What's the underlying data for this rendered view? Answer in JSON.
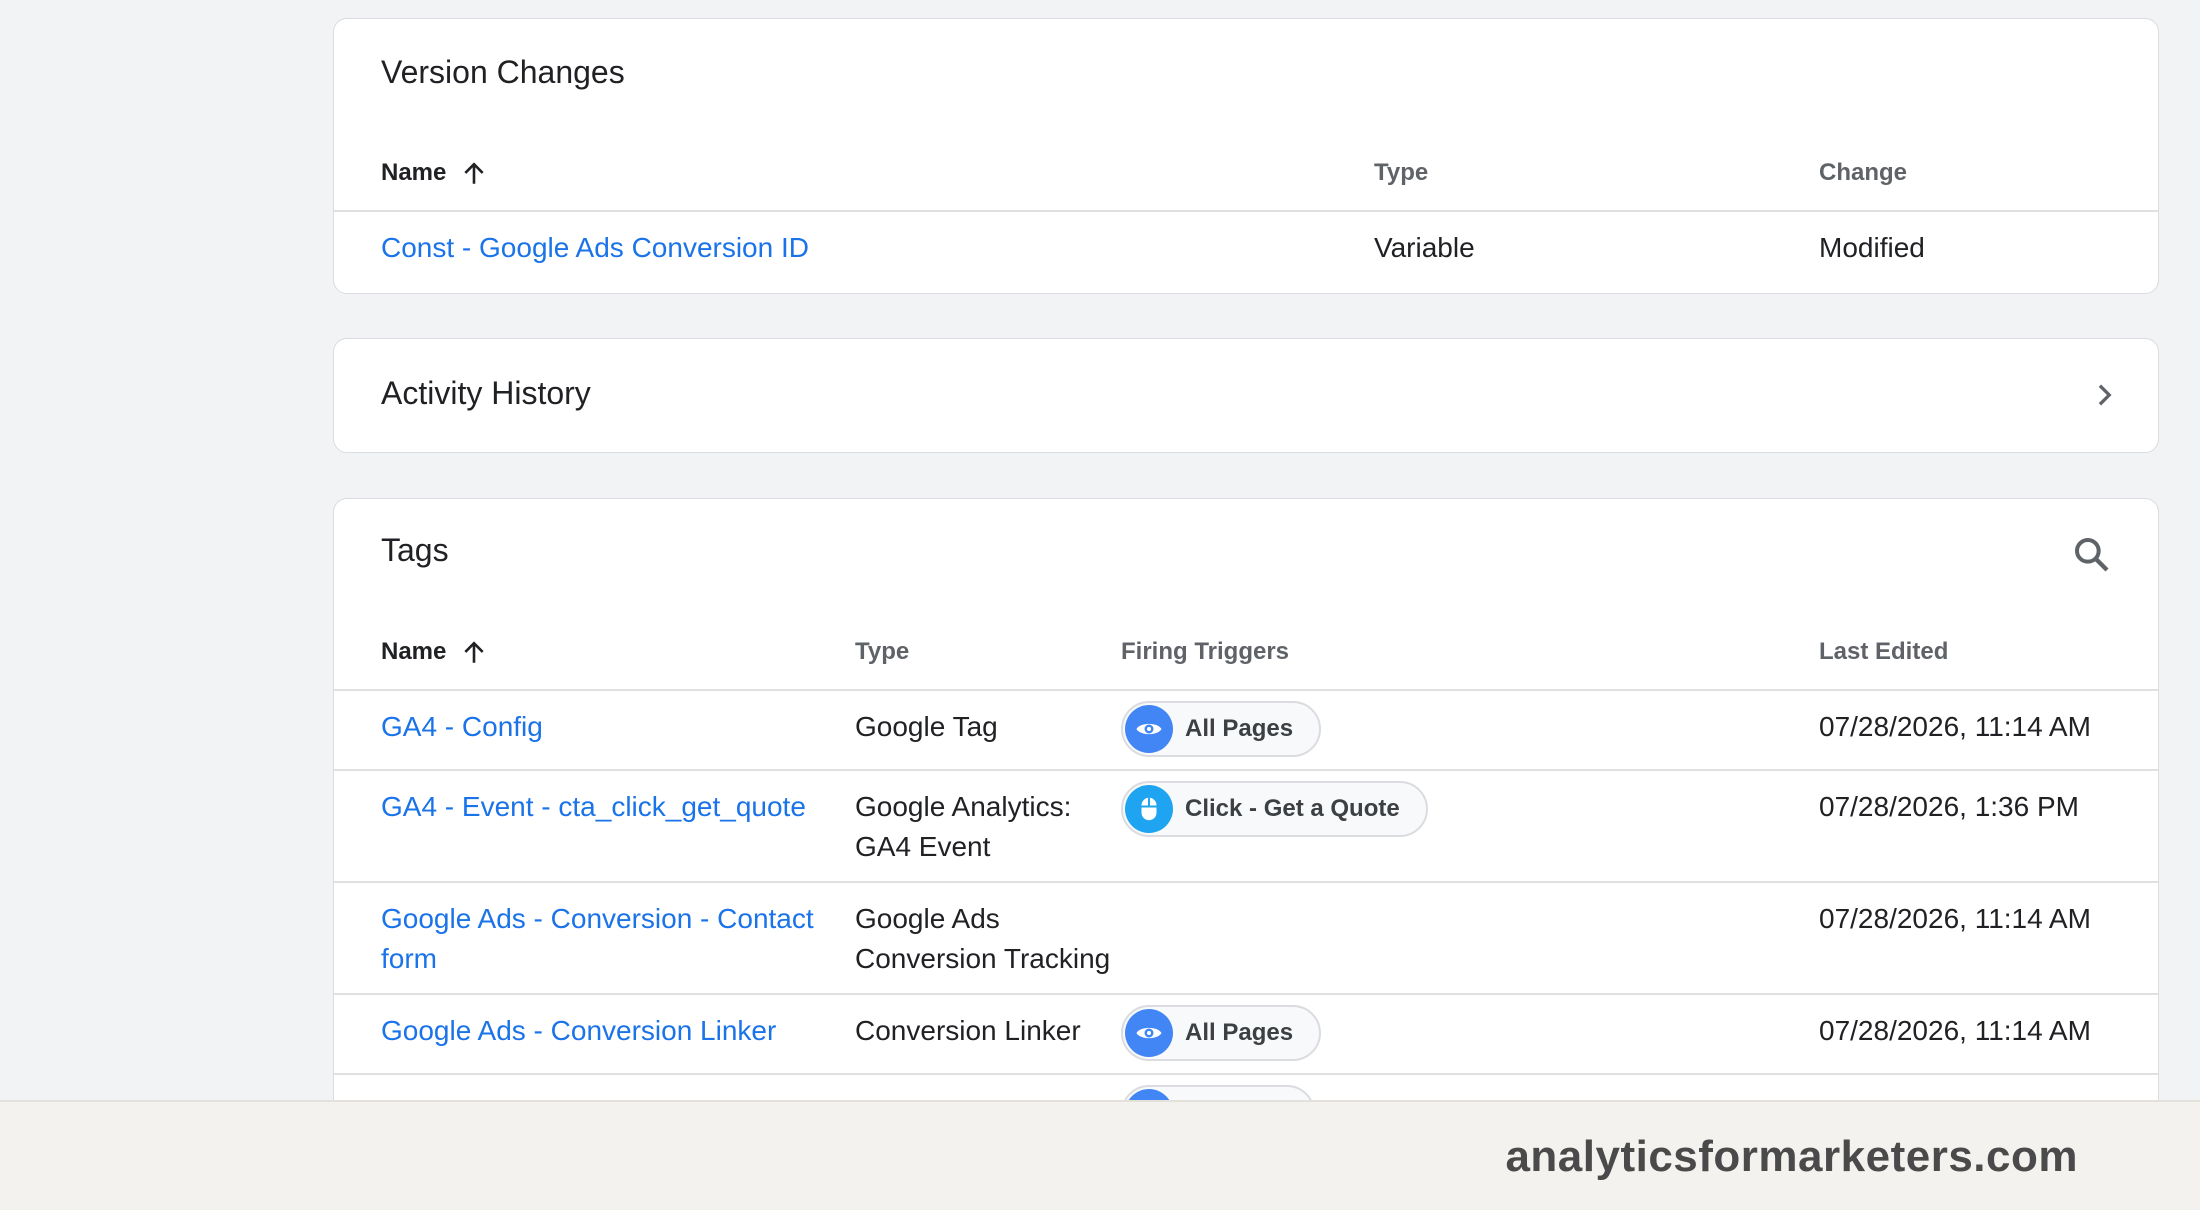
{
  "version_changes": {
    "title": "Version Changes",
    "columns": {
      "name": "Name",
      "type": "Type",
      "change": "Change"
    },
    "rows": [
      {
        "name": "Const - Google Ads Conversion ID",
        "type": "Variable",
        "change": "Modified"
      }
    ]
  },
  "activity_history": {
    "title": "Activity History"
  },
  "tags": {
    "title": "Tags",
    "columns": {
      "name": "Name",
      "type": "Type",
      "firing_triggers": "Firing Triggers",
      "last_edited": "Last Edited"
    },
    "rows": [
      {
        "name": "GA4 - Config",
        "type": "Google Tag",
        "trigger": "All Pages",
        "trigger_icon": "eye-icon",
        "last_edited": "07/28/2026, 11:14 AM"
      },
      {
        "name": "GA4 - Event - cta_click_get_quote",
        "type_line1": "Google Analytics:",
        "type_line2": "GA4 Event",
        "trigger": "Click - Get a Quote",
        "trigger_icon": "mouse-icon",
        "last_edited": "07/28/2026, 1:36 PM"
      },
      {
        "name_line1": "Google Ads - Conversion - Contact",
        "name_line2": "form",
        "type_line1": "Google Ads",
        "type_line2": "Conversion Tracking",
        "last_edited": "07/28/2026, 11:14 AM"
      },
      {
        "name": "Google Ads - Conversion Linker",
        "type": "Conversion Linker",
        "trigger": "All Pages",
        "trigger_icon": "eye-icon",
        "last_edited": "07/28/2026, 11:14 AM"
      }
    ]
  },
  "footer": {
    "brand": "analyticsformarketers.com"
  },
  "colors": {
    "link": "#1a73e8",
    "eye_chip": "#4285f4",
    "click_chip": "#1ea4f0",
    "background": "#f1f3f4"
  }
}
